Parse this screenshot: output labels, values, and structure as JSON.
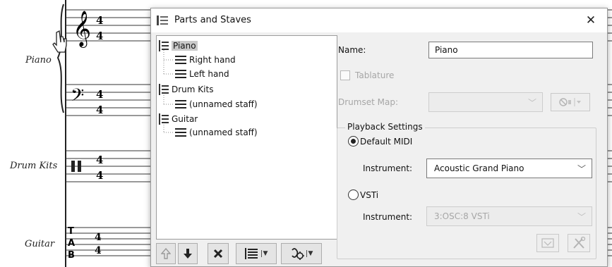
{
  "score": {
    "instruments": [
      {
        "label": "Piano"
      },
      {
        "label": "Drum Kits"
      },
      {
        "label": "Guitar"
      }
    ],
    "time_signature": [
      "4",
      "4"
    ],
    "tab_letters": [
      "T",
      "A",
      "B"
    ]
  },
  "dialog": {
    "title": "Parts and Staves",
    "close_glyph": "✕",
    "tree": [
      {
        "part": "Piano",
        "selected": true,
        "staves": [
          "Right hand",
          "Left hand"
        ]
      },
      {
        "part": "Drum Kits",
        "selected": false,
        "staves": [
          "(unnamed staff)"
        ]
      },
      {
        "part": "Guitar",
        "selected": false,
        "staves": [
          "(unnamed staff)"
        ]
      }
    ],
    "tree_buttons": [
      {
        "icon": "arrow-up-icon",
        "enabled": false
      },
      {
        "icon": "arrow-down-icon",
        "enabled": true
      },
      {
        "icon": "delete-x-icon",
        "enabled": true
      },
      {
        "icon": "add-staff-icon",
        "has_dropdown": true
      },
      {
        "icon": "instrument-settings-icon",
        "has_dropdown": true
      }
    ],
    "name_label": "Name:",
    "name_value": "Piano",
    "tablature_label": "Tablature",
    "drumset_map_label": "Drumset Map:",
    "playback": {
      "legend": "Playback Settings",
      "default_midi_label": "Default MIDI",
      "default_midi_selected": true,
      "instrument_label": "Instrument:",
      "instrument_value": "Acoustic Grand Piano",
      "vsti_label": "VSTi",
      "vsti_instrument_label": "Instrument:",
      "vsti_instrument_value": "3:OSC:8 VSTi"
    }
  }
}
